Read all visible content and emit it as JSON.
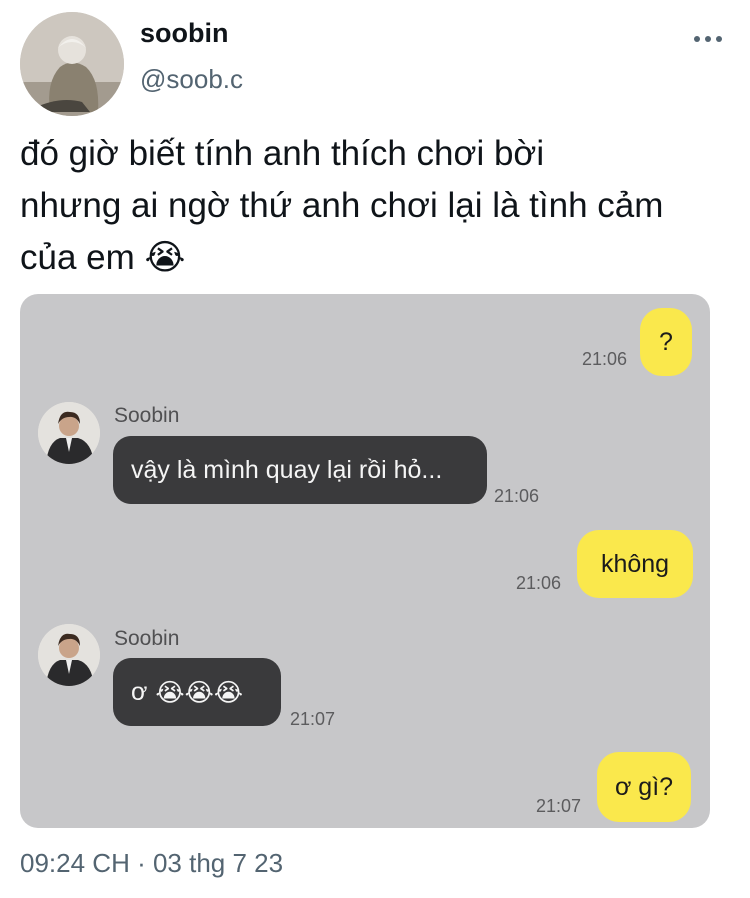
{
  "header": {
    "display_name": "soobin",
    "handle": "@soob.c",
    "more_icon": "more-horizontal-icon"
  },
  "tweet": {
    "line1": "đó giờ biết tính anh thích chơi bời",
    "line2": "nhưng ai ngờ thứ anh chơi lại là tình cảm",
    "line3": "của em",
    "emoji": "😭"
  },
  "chat": {
    "msg1": {
      "text": "?",
      "time": "21:06"
    },
    "msg2": {
      "sender": "Soobin",
      "text": "vậy là mình quay lại rồi hỏ...",
      "time": "21:06"
    },
    "msg3": {
      "text": "không",
      "time": "21:06"
    },
    "msg4": {
      "sender": "Soobin",
      "prefix": "ơ",
      "emojis": "😭😭😭",
      "time": "21:07"
    },
    "msg5": {
      "text": "ơ gì?",
      "time": "21:07"
    }
  },
  "footer": {
    "timestamp": "09:24 CH · 03 thg 7 23"
  },
  "colors": {
    "chat_bg": "#c7c7c9",
    "outgoing_bubble": "#fae84c",
    "incoming_bubble": "#3a3a3c",
    "secondary_text": "#536471"
  }
}
